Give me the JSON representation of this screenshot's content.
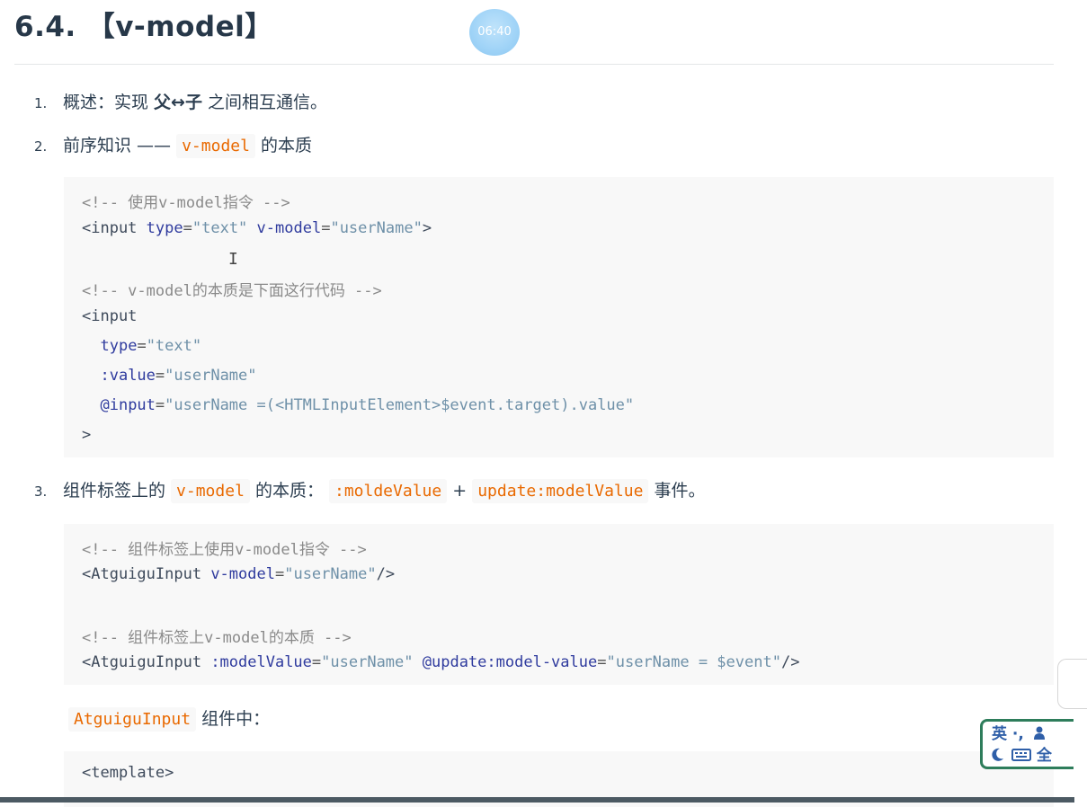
{
  "heading": {
    "number": "6.4.",
    "title": "【v-model】"
  },
  "timer": "06:40",
  "list": [
    {
      "num": "1.",
      "prefix": "概述：实现 ",
      "bold": "父↔子",
      "suffix": " 之间相互通信。"
    },
    {
      "num": "2.",
      "prefix": "前序知识 —— ",
      "code": "v-model",
      "suffix": " 的本质"
    },
    {
      "num": "3.",
      "prefix": "组件标签上的 ",
      "code1": "v-model",
      "mid1": " 的本质：",
      "code2": ":moldeValue",
      "mid2": " + ",
      "code3": "update:modelValue",
      "suffix": " 事件。"
    }
  ],
  "code1": {
    "l1_comment": "<!-- 使用v-model指令 -->",
    "l2": {
      "open": "<input",
      "a1": "type",
      "eq1": "=",
      "v1": "\"text\"",
      "a2": "v-model",
      "eq2": "=",
      "v2": "\"userName\"",
      "close": ">"
    },
    "l4_comment": "<!-- v-model的本质是下面这行代码 -->",
    "l5": "<input",
    "l6": {
      "a": "type",
      "eq": "=",
      "v": "\"text\""
    },
    "l7": {
      "a": ":value",
      "eq": "=",
      "v": "\"userName\""
    },
    "l8": {
      "a": "@input",
      "eq": "=",
      "v": "\"userName =(<HTMLInputElement>$event.target).value\""
    },
    "l9": ">"
  },
  "code2": {
    "l1_comment": "<!-- 组件标签上使用v-model指令 -->",
    "l2": {
      "open": "<AtguiguInput",
      "a1": "v-model",
      "eq1": "=",
      "v1": "\"userName\"",
      "close": "/>"
    },
    "l4_comment": "<!-- 组件标签上v-model的本质 -->",
    "l5": {
      "open": "<AtguiguInput",
      "a1": ":modelValue",
      "eq1": "=",
      "v1": "\"userName\"",
      "a2": "@update:model-value",
      "eq2": "=",
      "v2": "\"userName = $event\"",
      "close": "/>"
    }
  },
  "para": {
    "code": "AtguiguInput",
    "text": " 组件中："
  },
  "code3": {
    "l1": "<template>"
  },
  "text_cursor": "I",
  "ime": {
    "row1": "英 ·,",
    "row2": "全"
  },
  "icons": {
    "moon": "moon-icon",
    "keyboard": "keyboard-icon",
    "user": "user-icon"
  },
  "colors": {
    "inline_code": "#e96900",
    "code_bg": "#f8f8f8",
    "ime_border": "#2e7d5b"
  }
}
